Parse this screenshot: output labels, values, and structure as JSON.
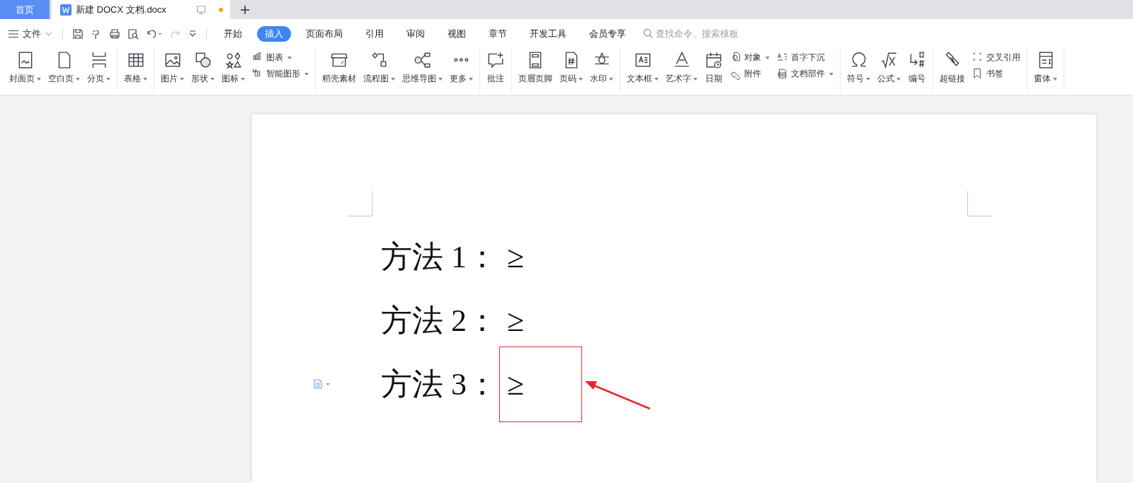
{
  "tabs": [
    {
      "label": "首页",
      "kind": "home",
      "selected": false
    },
    {
      "label": "新建 DOCX 文档.docx",
      "kind": "doc",
      "selected": true,
      "modified": true
    }
  ],
  "file_menu": {
    "label": "文件"
  },
  "menu_tabs": [
    {
      "label": "开始",
      "selected": false
    },
    {
      "label": "插入",
      "selected": true
    },
    {
      "label": "页面布局",
      "selected": false
    },
    {
      "label": "引用",
      "selected": false
    },
    {
      "label": "审阅",
      "selected": false
    },
    {
      "label": "视图",
      "selected": false
    },
    {
      "label": "章节",
      "selected": false
    },
    {
      "label": "开发工具",
      "selected": false
    },
    {
      "label": "会员专享",
      "selected": false
    }
  ],
  "search": {
    "placeholder": "查找命令、搜索模板"
  },
  "ribbon": [
    {
      "columns": [
        {
          "kind": "big",
          "items": [
            {
              "label": "封面页",
              "dropdown": true
            }
          ]
        },
        {
          "kind": "big",
          "items": [
            {
              "label": "空白页",
              "dropdown": true
            }
          ]
        },
        {
          "kind": "big",
          "items": [
            {
              "label": "分页",
              "dropdown": true
            }
          ]
        }
      ]
    },
    {
      "columns": [
        {
          "kind": "big",
          "items": [
            {
              "label": "表格",
              "dropdown": true
            }
          ]
        }
      ]
    },
    {
      "columns": [
        {
          "kind": "big",
          "items": [
            {
              "label": "图片",
              "dropdown": true
            }
          ]
        },
        {
          "kind": "big",
          "items": [
            {
              "label": "形状",
              "dropdown": true
            }
          ]
        },
        {
          "kind": "big",
          "items": [
            {
              "label": "图标",
              "dropdown": true
            }
          ]
        },
        {
          "kind": "stack",
          "items": [
            {
              "label": "图表",
              "dropdown": true
            },
            {
              "label": "智能图形",
              "dropdown": true
            }
          ]
        }
      ]
    },
    {
      "columns": [
        {
          "kind": "big",
          "items": [
            {
              "label": "稻壳素材",
              "dropdown": false
            }
          ]
        },
        {
          "kind": "big",
          "items": [
            {
              "label": "流程图",
              "dropdown": true
            }
          ]
        },
        {
          "kind": "big",
          "items": [
            {
              "label": "思维导图",
              "dropdown": true
            }
          ]
        },
        {
          "kind": "big",
          "items": [
            {
              "label": "更多",
              "dropdown": true
            }
          ]
        }
      ]
    },
    {
      "columns": [
        {
          "kind": "big",
          "items": [
            {
              "label": "批注",
              "dropdown": false
            }
          ]
        }
      ]
    },
    {
      "columns": [
        {
          "kind": "big",
          "items": [
            {
              "label": "页眉页脚",
              "dropdown": false
            }
          ]
        },
        {
          "kind": "big",
          "items": [
            {
              "label": "页码",
              "dropdown": true
            }
          ]
        },
        {
          "kind": "big",
          "items": [
            {
              "label": "水印",
              "dropdown": true
            }
          ]
        }
      ]
    },
    {
      "columns": [
        {
          "kind": "big",
          "items": [
            {
              "label": "文本框",
              "dropdown": true
            }
          ]
        },
        {
          "kind": "big",
          "items": [
            {
              "label": "艺术字",
              "dropdown": true
            }
          ]
        },
        {
          "kind": "big",
          "items": [
            {
              "label": "日期",
              "dropdown": false
            }
          ]
        },
        {
          "kind": "stack",
          "items": [
            {
              "label": "对象",
              "dropdown": true
            },
            {
              "label": "附件",
              "dropdown": false
            }
          ]
        },
        {
          "kind": "stack",
          "items": [
            {
              "label": "首字下沉",
              "dropdown": false
            },
            {
              "label": "文档部件",
              "dropdown": true
            }
          ]
        }
      ]
    },
    {
      "columns": [
        {
          "kind": "big",
          "items": [
            {
              "label": "符号",
              "dropdown": true
            }
          ]
        },
        {
          "kind": "big",
          "items": [
            {
              "label": "公式",
              "dropdown": true
            }
          ]
        },
        {
          "kind": "big",
          "items": [
            {
              "label": "编号",
              "dropdown": false
            }
          ]
        }
      ]
    },
    {
      "columns": [
        {
          "kind": "big",
          "items": [
            {
              "label": "超链接",
              "dropdown": false
            }
          ]
        },
        {
          "kind": "stack",
          "items": [
            {
              "label": "交叉引用",
              "dropdown": false
            },
            {
              "label": "书签",
              "dropdown": false
            }
          ]
        }
      ]
    },
    {
      "columns": [
        {
          "kind": "big",
          "items": [
            {
              "label": "窗体",
              "dropdown": true
            }
          ]
        }
      ]
    }
  ],
  "document": {
    "lines": [
      {
        "label": "方法 1：",
        "symbol": "≥",
        "highlighted": false
      },
      {
        "label": "方法 2：",
        "symbol": "≥",
        "highlighted": false
      },
      {
        "label": "方法 3：",
        "symbol": "≥",
        "highlighted": true
      }
    ]
  }
}
